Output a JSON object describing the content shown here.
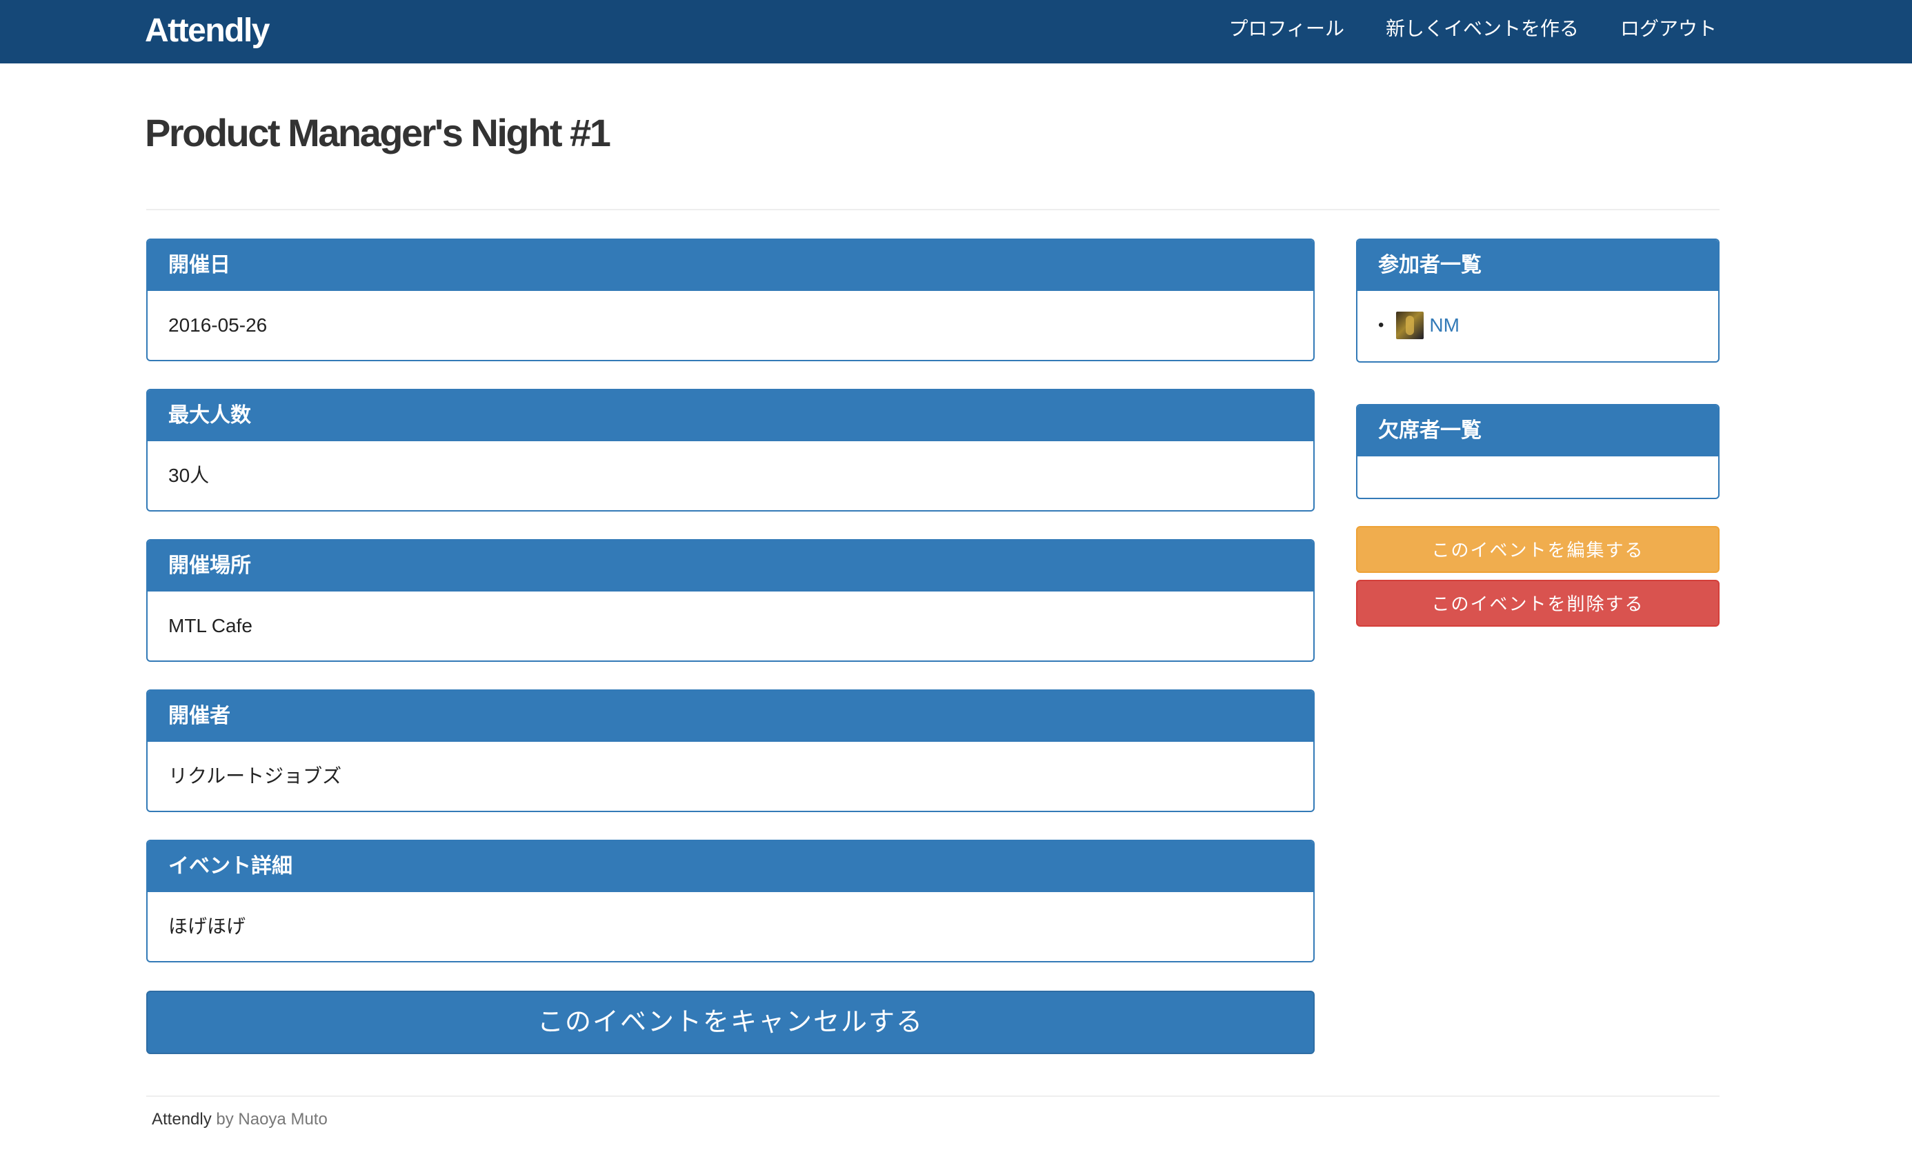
{
  "navbar": {
    "brand": "Attendly",
    "links": [
      "プロフィール",
      "新しくイベントを作る",
      "ログアウト"
    ]
  },
  "page": {
    "title": "Product Manager's Night #1"
  },
  "details": [
    {
      "heading": "開催日",
      "value": "2016-05-26"
    },
    {
      "heading": "最大人数",
      "value": "30人"
    },
    {
      "heading": "開催場所",
      "value": "MTL Cafe"
    },
    {
      "heading": "開催者",
      "value": "リクルートジョブズ"
    },
    {
      "heading": "イベント詳細",
      "value": "ほげほげ"
    }
  ],
  "cancel_button": "このイベントをキャンセルする",
  "attendees": {
    "heading": "参加者一覧",
    "items": [
      {
        "name": "NM"
      }
    ]
  },
  "absentees": {
    "heading": "欠席者一覧",
    "items": []
  },
  "edit_button": "このイベントを編集する",
  "delete_button": "このイベントを削除する",
  "footer": {
    "brand": "Attendly",
    "byline": " by Naoya Muto"
  },
  "colors": {
    "navbar": "#154878",
    "primary": "#337ab7",
    "warning": "#f0ad4e",
    "danger": "#d9534f"
  }
}
